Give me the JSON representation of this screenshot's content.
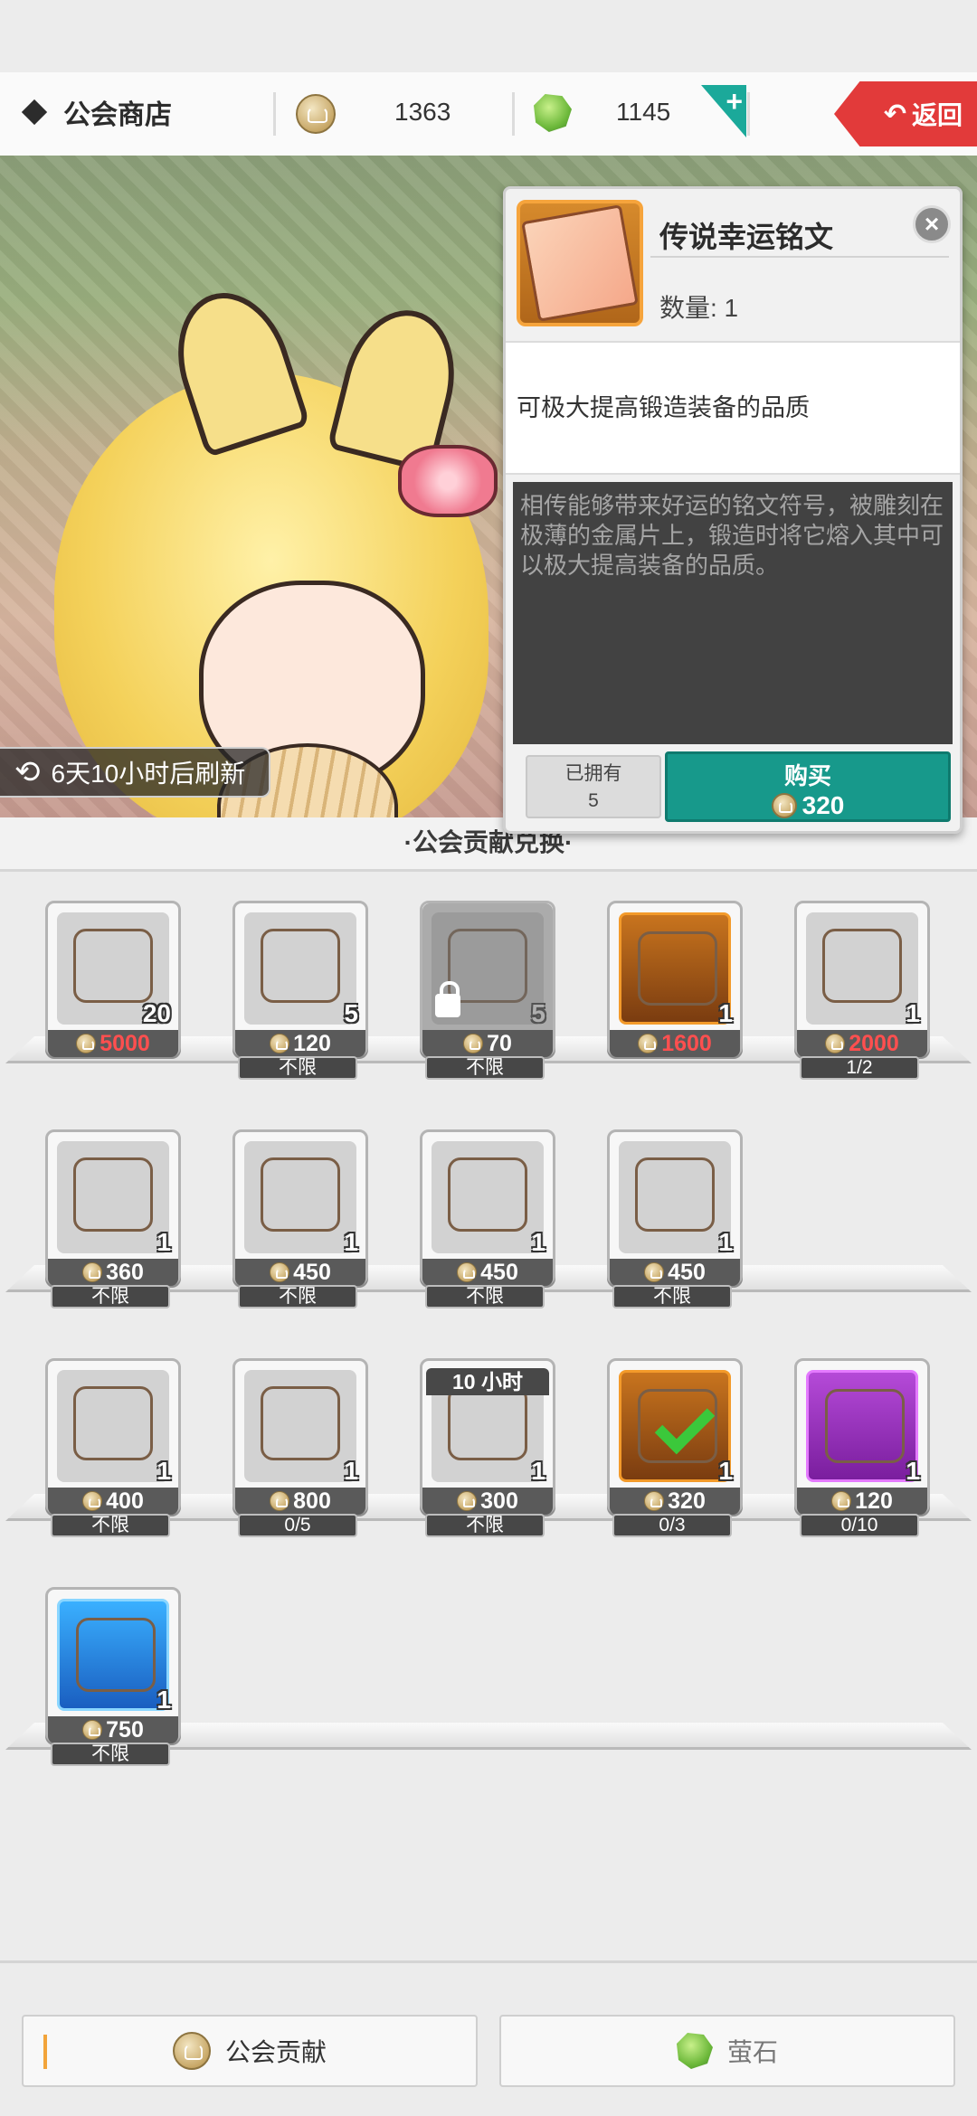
{
  "header": {
    "title": "公会商店",
    "contribution_amount": "1363",
    "gem_amount": "1145",
    "plus_label": "+",
    "back_label": "返回"
  },
  "banner": {
    "refresh_text": "6天10小时后刷新"
  },
  "popup": {
    "item_name": "传说幸运铭文",
    "quantity_text": "数量: 1",
    "effect": "可极大提高锻造装备的品质",
    "description": "相传能够带来好运的铭文符号，被雕刻在极薄的金属片上，锻造时将它熔入其中可以极大提高装备的品质。",
    "owned_label": "已拥有",
    "owned_count": "5",
    "buy_label": "购买",
    "buy_price": "320",
    "close_icon": "close-icon"
  },
  "section": {
    "title": "·公会贡献兑换·"
  },
  "items": [
    {
      "qty": "20",
      "price": "5000",
      "limit": "",
      "style": "gray",
      "red": true,
      "locked": false
    },
    {
      "qty": "5",
      "price": "120",
      "limit": "不限",
      "style": "gray",
      "red": false,
      "locked": false
    },
    {
      "qty": "5",
      "price": "70",
      "limit": "不限",
      "style": "gray",
      "red": false,
      "locked": true
    },
    {
      "qty": "1",
      "price": "1600",
      "limit": "",
      "style": "orange",
      "red": true,
      "locked": false
    },
    {
      "qty": "1",
      "price": "2000",
      "limit": "1/2",
      "style": "gray",
      "red": true,
      "locked": false
    },
    {
      "qty": "1",
      "price": "360",
      "limit": "不限",
      "style": "gray",
      "red": false,
      "locked": false
    },
    {
      "qty": "1",
      "price": "450",
      "limit": "不限",
      "style": "gray",
      "red": false,
      "locked": false
    },
    {
      "qty": "1",
      "price": "450",
      "limit": "不限",
      "style": "gray",
      "red": false,
      "locked": false
    },
    {
      "qty": "1",
      "price": "450",
      "limit": "不限",
      "style": "gray",
      "red": false,
      "locked": false
    },
    {
      "qty": "1",
      "price": "400",
      "limit": "不限",
      "style": "gray",
      "red": false,
      "locked": false
    },
    {
      "qty": "1",
      "price": "800",
      "limit": "0/5",
      "style": "gray",
      "red": false,
      "locked": false
    },
    {
      "qty": "1",
      "price": "300",
      "limit": "不限",
      "style": "gray",
      "red": false,
      "locked": false,
      "timer": "10 小时"
    },
    {
      "qty": "1",
      "price": "320",
      "limit": "0/3",
      "style": "orange",
      "red": false,
      "locked": false,
      "checked": true
    },
    {
      "qty": "1",
      "price": "120",
      "limit": "0/10",
      "style": "purple",
      "red": false,
      "locked": false
    },
    {
      "qty": "1",
      "price": "750",
      "limit": "不限",
      "style": "blue",
      "red": false,
      "locked": false
    }
  ],
  "footer": {
    "tab_contribution": "公会贡献",
    "tab_gem": "萤石"
  },
  "colors": {
    "accent_teal": "#17998b",
    "back_red": "#e23a3a",
    "price_red": "#ff4f4f"
  }
}
